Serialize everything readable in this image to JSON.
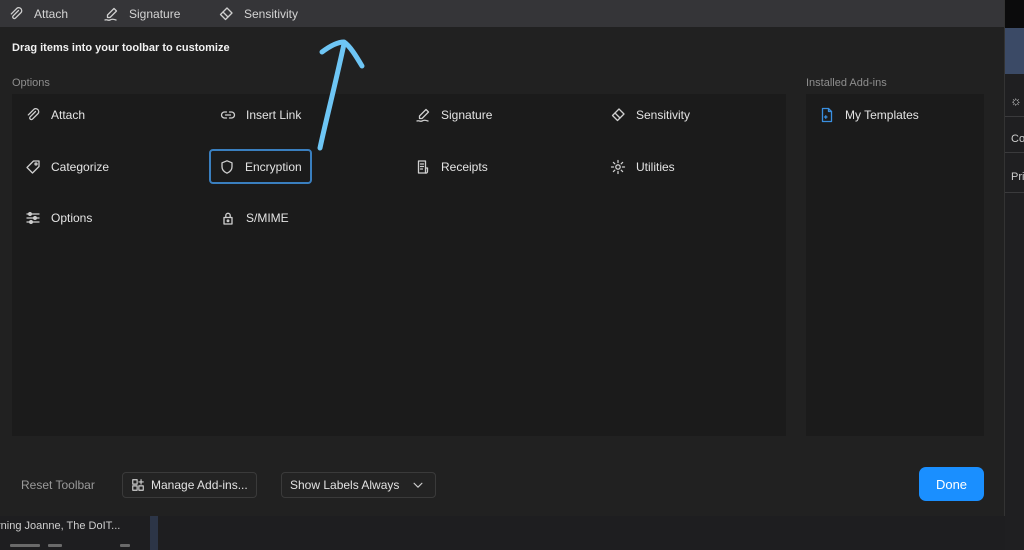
{
  "toolbar_strip": {
    "items": [
      {
        "label": "Attach",
        "icon": "paperclip-icon"
      },
      {
        "label": "Signature",
        "icon": "signature-pen-icon"
      },
      {
        "label": "Sensitivity",
        "icon": "sensitivity-brush-icon"
      }
    ]
  },
  "dialog": {
    "instruction": "Drag items into your toolbar to customize",
    "options_heading": "Options",
    "addins_heading": "Installed Add-ins",
    "options": [
      {
        "label": "Attach",
        "icon": "paperclip-icon"
      },
      {
        "label": "Insert Link",
        "icon": "link-icon"
      },
      {
        "label": "Signature",
        "icon": "signature-pen-icon"
      },
      {
        "label": "Sensitivity",
        "icon": "sensitivity-brush-icon"
      },
      {
        "label": "Categorize",
        "icon": "tag-icon"
      },
      {
        "label": "Encryption",
        "icon": "shield-icon",
        "focused": true
      },
      {
        "label": "Receipts",
        "icon": "receipt-icon"
      },
      {
        "label": "Utilities",
        "icon": "gear-icon"
      },
      {
        "label": "Options",
        "icon": "sliders-icon"
      },
      {
        "label": "S/MIME",
        "icon": "lock-badge-icon"
      }
    ],
    "addins": [
      {
        "label": "My Templates",
        "icon": "template-document-icon"
      }
    ],
    "footer": {
      "reset_label": "Reset Toolbar",
      "manage_label": "Manage Add-ins...",
      "labels_label": "Show Labels Always",
      "done_label": "Done"
    }
  },
  "background": {
    "message_preview": "rning Joanne, The DoIT...",
    "right_fragments": [
      "Co",
      "Pri"
    ]
  },
  "colors": {
    "accent": "#1a8fff",
    "focus_border": "#3a7fbf",
    "annotation": "#6ec6f5",
    "dialog_bg": "#212121"
  }
}
